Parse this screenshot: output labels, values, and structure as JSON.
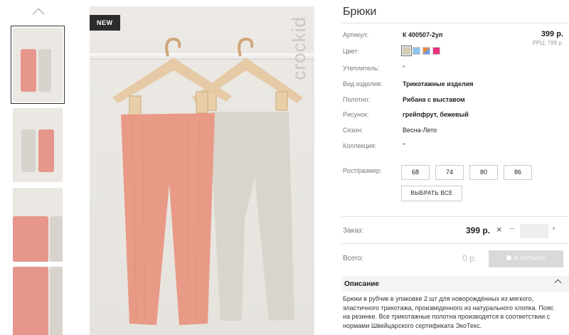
{
  "product": {
    "title": "Брюки",
    "badge": "NEW",
    "brand_watermark": "crockid",
    "price": "399 р.",
    "rrp": "РРЦ: 799 р."
  },
  "attributes": [
    {
      "label": "Артикул:",
      "value": "К 400507-2уп"
    },
    {
      "label": "Цвет:",
      "value": ""
    },
    {
      "label": "Утеплитель:",
      "value": "\""
    },
    {
      "label": "Вид изделия:",
      "value": "Трикотажные изделия"
    },
    {
      "label": "Полотно:",
      "value": "Рибана с выставом"
    },
    {
      "label": "Рисунок:",
      "value": "грейпфрут, бежевый"
    },
    {
      "label": "Сезон:",
      "value": "Весна-Лето"
    },
    {
      "label": "Коллекция:",
      "value": "\""
    },
    {
      "label": "Рост/размер:",
      "value": ""
    }
  ],
  "colors": [
    "#d6cbb4",
    "#8cc6ea",
    "#f08a3c",
    "#e8327c"
  ],
  "sizes": [
    "68",
    "74",
    "80",
    "86"
  ],
  "select_all_label": "ВЫБРАТЬ ВСЕ",
  "order": {
    "label": "Заказ:",
    "price": "399 р.",
    "times": "×",
    "minus": "−",
    "plus": "+",
    "quantity": ""
  },
  "total": {
    "label": "Всего:",
    "price": "0 р.",
    "cart_label": "В КОРЗИНУ"
  },
  "description": {
    "title": "Описание",
    "text": "Брюки в рубчик в упаковке 2 шт для новорождённых из мягкого, эластичного трикотажа, произведенного из натурального хлопка. Пояс на резинке. Все трикотажные полотна производятся в соответствии с нормами Швейцарского сертификата ЭкоТекс."
  },
  "colors_theme": {
    "coral": "#e89a86",
    "beige": "#d9d4cc",
    "wood": "#e6caa6"
  }
}
